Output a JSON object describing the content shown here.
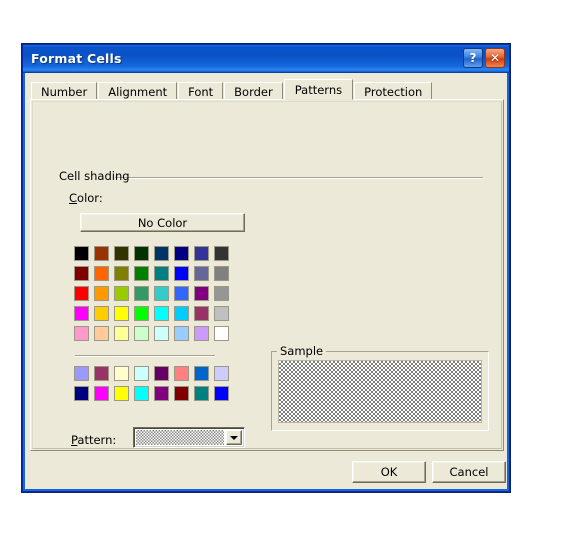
{
  "window": {
    "title": "Format Cells",
    "help_button": "?",
    "close_button": "✕",
    "titlebar_color": "#0a52c6"
  },
  "tabs": [
    {
      "label": "Number",
      "active": false
    },
    {
      "label": "Alignment",
      "active": false
    },
    {
      "label": "Font",
      "active": false
    },
    {
      "label": "Border",
      "active": false
    },
    {
      "label": "Patterns",
      "active": true
    },
    {
      "label": "Protection",
      "active": false
    }
  ],
  "cell_shading": {
    "group_label": "Cell shading",
    "color_label_accel": "C",
    "color_label_rest": "olor:",
    "no_color_button": "No Color"
  },
  "palette": {
    "main_rows": [
      [
        "#000000",
        "#993300",
        "#333300",
        "#003300",
        "#003366",
        "#000080",
        "#333399",
        "#333333"
      ],
      [
        "#800000",
        "#FF6600",
        "#808000",
        "#008000",
        "#008080",
        "#0000FF",
        "#666699",
        "#808080"
      ],
      [
        "#FF0000",
        "#FF9900",
        "#99CC00",
        "#339966",
        "#33CCCC",
        "#3366FF",
        "#800080",
        "#969696"
      ],
      [
        "#FF00FF",
        "#FFCC00",
        "#FFFF00",
        "#00FF00",
        "#00FFFF",
        "#00CCFF",
        "#993366",
        "#C0C0C0"
      ],
      [
        "#FF99CC",
        "#FFCC99",
        "#FFFF99",
        "#CCFFCC",
        "#CCFFFF",
        "#99CCFF",
        "#CC99FF",
        "#FFFFFF"
      ]
    ],
    "custom_rows": [
      [
        "#9999FF",
        "#993366",
        "#FFFFCC",
        "#CCFFFF",
        "#660066",
        "#FF8080",
        "#0066CC",
        "#CCCCFF"
      ],
      [
        "#000080",
        "#FF00FF",
        "#FFFF00",
        "#00FFFF",
        "#800080",
        "#800000",
        "#008080",
        "#0000FF"
      ]
    ]
  },
  "pattern": {
    "label_accel": "P",
    "label_rest": "attern:",
    "selected_value": "12.5% Gray",
    "dropdown_arrow": "▼"
  },
  "sample": {
    "group_label": "Sample"
  },
  "footer": {
    "ok_label": "OK",
    "cancel_label": "Cancel"
  }
}
